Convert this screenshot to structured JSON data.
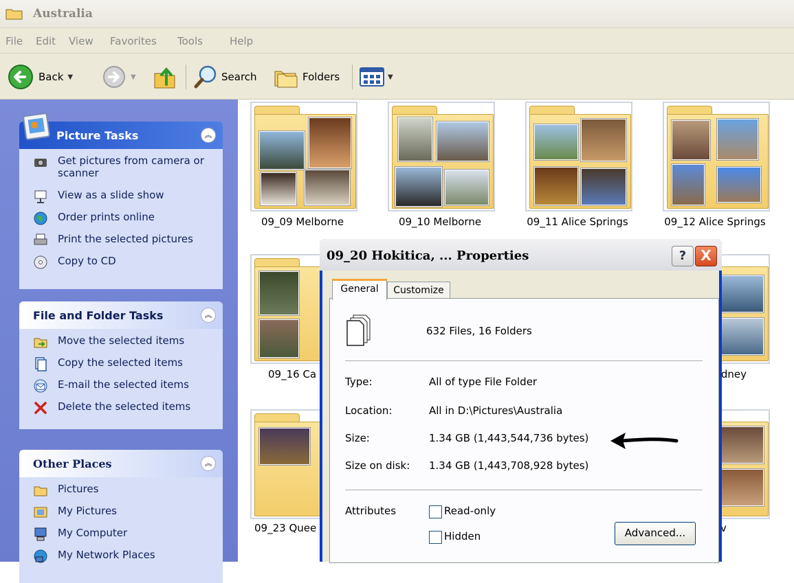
{
  "window": {
    "title": "Australia"
  },
  "menu": [
    "File",
    "Edit",
    "View",
    "Favorites",
    "Tools",
    "Help"
  ],
  "toolbar": {
    "back": "Back",
    "search": "Search",
    "folders": "Folders"
  },
  "picture_tasks": {
    "title": "Picture Tasks",
    "items": [
      "Get pictures from camera or scanner",
      "View as a slide show",
      "Order prints online",
      "Print the selected pictures",
      "Copy to CD"
    ]
  },
  "file_tasks": {
    "title": "File and Folder Tasks",
    "items": [
      "Move the selected items",
      "Copy the selected items",
      "E-mail the selected items",
      "Delete the selected items"
    ]
  },
  "other_places": {
    "title": "Other Places",
    "items": [
      "Pictures",
      "My Pictures",
      "My Computer",
      "My Network Places"
    ]
  },
  "folders": [
    {
      "name": "09_09 Melborne"
    },
    {
      "name": "09_10 Melborne"
    },
    {
      "name": "09_11 Alice Springs"
    },
    {
      "name": "09_12 Alice Springs"
    },
    {
      "name": "09_16 Ca"
    },
    {
      "name": "ydney"
    },
    {
      "name": "09_23 Quee"
    },
    {
      "name": "v"
    }
  ],
  "dialog": {
    "title": "09_20 Hokitica, ... Properties",
    "help": "?",
    "close": "X",
    "tabs": [
      "General",
      "Customize"
    ],
    "summary": "632 Files, 16 Folders",
    "type_label": "Type:",
    "type_value": "All of type File Folder",
    "location_label": "Location:",
    "location_value": "All in D:\\Pictures\\Australia",
    "size_label": "Size:",
    "size_value": "1.34 GB (1,443,544,736 bytes)",
    "size_on_disk_label": "Size on disk:",
    "size_on_disk_value": "1.34 GB (1,443,708,928 bytes)",
    "attributes_label": "Attributes",
    "readonly_label": "Read-only",
    "hidden_label": "Hidden",
    "advanced_label": "Advanced..."
  }
}
